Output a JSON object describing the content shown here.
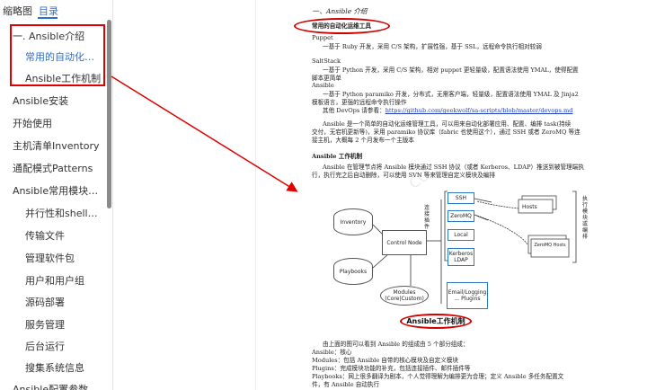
{
  "sidebar": {
    "tabs": [
      {
        "label": "缩略图"
      },
      {
        "label": "目录"
      }
    ],
    "items": [
      {
        "label": "一. Ansible介绍"
      },
      {
        "label": "常用的自动化运维..."
      },
      {
        "label": "Ansible工作机制"
      },
      {
        "label": "Ansible安装"
      },
      {
        "label": "开始使用"
      },
      {
        "label": "主机清单Inventory"
      },
      {
        "label": "通配模式Patterns"
      },
      {
        "label": "Ansible常用模块的操..."
      },
      {
        "label": "并行性和shell命令"
      },
      {
        "label": "传输文件"
      },
      {
        "label": "管理软件包"
      },
      {
        "label": "用户和用户组"
      },
      {
        "label": "源码部署"
      },
      {
        "label": "服务管理"
      },
      {
        "label": "后台运行"
      },
      {
        "label": "搜集系统信息"
      },
      {
        "label": "Ansible配置参数"
      }
    ]
  },
  "document": {
    "heading_prefix": "一、",
    "heading_title": "Ansible 介绍",
    "section1_title": "常用的自动化运维工具",
    "puppet_name": "Puppet",
    "puppet_desc": "一基于 Ruby 开发，采用 C/S 架构，扩展性强，基于 SSL，远程命令执行相对较弱",
    "saltstack_name": "SaltStack",
    "saltstack_desc1": "一基于 Python 开发，采用 C/S 架构，相对 puppet 更轻量级，配置语法使用 YMAL，使得配置",
    "saltstack_desc2": "脚本更简单",
    "ansible_name": "Ansible",
    "ansible_desc1": "一基于 Python paramiko 开发，分布式，无需客户端，轻量级，配置语法使用 YMAL 及 Jinja2",
    "ansible_desc2": "模板语言，更强的远程命令执行操作",
    "devops_prefix": "其他 DevOps 请参看：",
    "devops_link": "https://github.com/geekwolf/sa-scripts/blob/master/devops.md",
    "intro1": "Ansible 是一个简单的自动化运维管理工具，可以用来自动化部署应用、配置、编排 task(持续",
    "intro2": "交付，无宕机更新等)，采用 paramiko 协议库（fabric 也使用这个），通过 SSH 或者 ZeroMQ 等连",
    "intro3": "接主机，大概每 2 个月发布一个主版本",
    "section2_title": "Ansible 工作机制",
    "mech1": "Ansible 在管理节点将 Ansible 模块通过 SSH 协议（或者 Kerberos、LDAP）推送到被管理端执",
    "mech2": "行，执行完之后自动删除，可以使用 SVN 等来管理自定义模块及编排",
    "after1": "由上面的图可以看到 Ansible 的组成由 5 个部分组成：",
    "after2": "Ansible：核心",
    "after3": "Modules：包括 Ansible 自带的核心模块及自定义模块",
    "after4": "Plugins：完成模块功能的补充，包括连接插件、邮件插件等",
    "after5": "Playbooks：网上很多翻译为剧本，个人觉得理解为编排更为合理；定义 Ansible 多任务配置文",
    "after6": "件，有 Ansible 自动执行",
    "watermark": "CU"
  },
  "diagram": {
    "inventory": "Inventory",
    "playbooks": "Playbooks",
    "control_node": "Control Node",
    "modules": "Modules (Core|Custom)",
    "ssh": "SSH",
    "zeromq": "ZeroMQ",
    "local": "Local",
    "kerberos": "Kerberos LDAP",
    "email": "Email/Logging ... Plugins",
    "hosts1": "Hosts",
    "hosts2": "ZeroMQ Hosts",
    "left_vertical": "连接插件",
    "right_vertical": "执行模块或编排",
    "caption": "Ansible工作机制"
  },
  "colors": {
    "accent": "#2b6fd6",
    "annotation_red": "#e00000"
  }
}
